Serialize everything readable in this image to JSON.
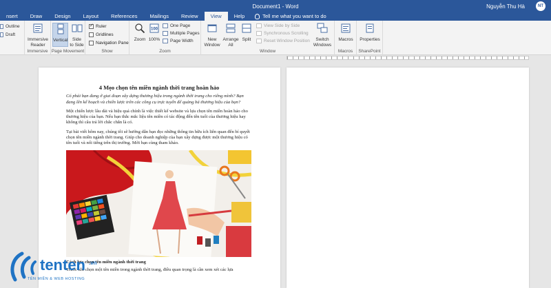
{
  "window": {
    "doc_title": "Document1 - Word",
    "user_name": "Nguyễn Thu Hà",
    "user_initials": "NT"
  },
  "tabs": [
    "nsert",
    "Draw",
    "Design",
    "Layout",
    "References",
    "Mailings",
    "Review",
    "View",
    "Help"
  ],
  "active_tab": "View",
  "tell_me": "Tell me what you want to do",
  "ribbon": {
    "views": {
      "outline": "Outline",
      "draft": "Draft"
    },
    "immersive": {
      "reader_line1": "Immersive",
      "reader_line2": "Reader",
      "group": "Immersive"
    },
    "page_movement": {
      "vertical": "Vertical",
      "side_line1": "Side",
      "side_line2": "to Side",
      "group": "Page Movement"
    },
    "show": {
      "ruler": "Ruler",
      "gridlines": "Gridlines",
      "navigation_pane": "Navigation Pane",
      "group": "Show",
      "ruler_checked": true,
      "gridlines_checked": false,
      "navigation_checked": false
    },
    "zoom": {
      "zoom": "Zoom",
      "zoom100": "100%",
      "one_page": "One Page",
      "multiple_pages": "Multiple Pages",
      "page_width": "Page Width",
      "group": "Zoom"
    },
    "window": {
      "new_line1": "New",
      "new_line2": "Window",
      "arrange_line1": "Arrange",
      "arrange_line2": "All",
      "split": "Split",
      "view_side_by_side": "View Side by Side",
      "sync_scrolling": "Synchronous Scrolling",
      "reset_position": "Reset Window Position",
      "switch_line1": "Switch",
      "switch_line2": "Windows",
      "group": "Window"
    },
    "macros": {
      "macros": "Macros",
      "group": "Macros"
    },
    "sharepoint": {
      "properties": "Properties",
      "group": "SharePoint"
    }
  },
  "document": {
    "title": "4 Mẹo chọn tên miền ngành thời trang hoàn hảo",
    "intro": "Có phải bạn đang ở giai đoạn xây dựng thương hiệu trong ngành thời trang cho riêng mình? Bạn đang lên kế hoạch và chiến lược trên các công cụ trực tuyến để quảng bá thương hiệu của bạn?",
    "para1": "Một chiến lược lâu dài và hiệu quả chính là việc thiết kế website và lựa chọn tên miền hoàn hảo cho thương hiệu của bạn. Nếu bạn thắc mắc liệu tên miền có tác động đến tên tuổi của thương hiệu hay không thì câu trả lời chắc chắn là có.",
    "para2": "Tại bài viết hôm nay, chúng tôi sẽ hướng dẫn bạn đọc những thông tin hữu ích liên quan đến bí quyết chọn tên miền ngành thời trang. Giúp cho doanh nghiệp của bạn xây dựng được một thương hiệu có tên tuổi và nổi tiếng trên thị trường. Mời bạn cùng tham khảo.",
    "subheading": "Cách lựa chọn tên miền ngành thời trang",
    "para3": "Trước khi chọn một tên miền trong ngành thời trang, điều quan trọng là cần xem xét các lựa"
  },
  "watermark": {
    "brand": "tenten",
    "suffix": ".vn",
    "tagline": "TÊN MIỀN & WEB HOSTING"
  },
  "colors": {
    "word_blue": "#2b579a",
    "ribbon_bg": "#f3f3f3",
    "canvas": "#e6e6e6",
    "logo_blue": "#1f73c4"
  }
}
